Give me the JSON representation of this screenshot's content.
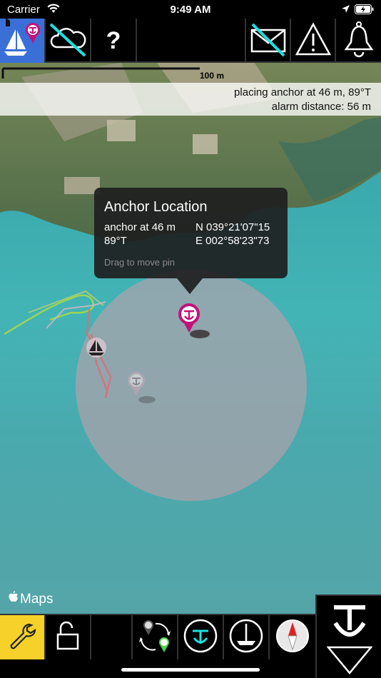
{
  "status_bar": {
    "carrier": "Carrier",
    "time": "9:49 AM",
    "icons": [
      "wifi-icon",
      "location-arrow-icon",
      "battery-charging-icon"
    ]
  },
  "top_toolbar": {
    "buttons": [
      {
        "name": "anchor-boat-mode-button",
        "icon": "sailboat-anchor-pin-icon",
        "active": true
      },
      {
        "name": "weather-off-button",
        "icon": "cloud-crossed-icon"
      },
      {
        "name": "help-button",
        "label": "?"
      },
      {
        "name": "empty-slot"
      },
      {
        "name": "messages-off-button",
        "icon": "envelope-crossed-icon"
      },
      {
        "name": "warning-button",
        "icon": "warning-triangle-icon"
      },
      {
        "name": "alarm-bell-button",
        "icon": "bell-icon"
      }
    ]
  },
  "map": {
    "scale_label": "100 m",
    "info_line_1": "placing anchor at 46 m, 89°T",
    "info_line_2": "alarm distance: 56 m",
    "attribution": "Maps",
    "popup": {
      "title": "Anchor Location",
      "distance": "anchor at 46 m",
      "bearing": "89°T",
      "latitude": "N 039°21'07\"15",
      "longitude": "E 002°58'23\"73",
      "hint": "Drag to move pin"
    },
    "colors": {
      "pin": "#c2127a",
      "alarm_circle": "#bea0aa",
      "track_green": "#a6d84a",
      "track_red": "#e06a74"
    }
  },
  "bottom_toolbar": {
    "buttons": [
      {
        "name": "settings-wrench-button",
        "icon": "wrench-icon"
      },
      {
        "name": "lock-button",
        "icon": "unlocked-padlock-icon"
      },
      {
        "name": "empty-slot"
      },
      {
        "name": "swap-anchors-button",
        "icon": "swap-anchor-pins-icon"
      },
      {
        "name": "anchor-view-button",
        "icon": "anchor-circle-icon"
      },
      {
        "name": "boat-view-button",
        "icon": "boat-circle-icon"
      },
      {
        "name": "compass-button",
        "icon": "compass-icon"
      }
    ],
    "anchor_panel": {
      "icon": "anchor-icon",
      "secondary_icon": "chevron-down-triangle-icon"
    }
  }
}
